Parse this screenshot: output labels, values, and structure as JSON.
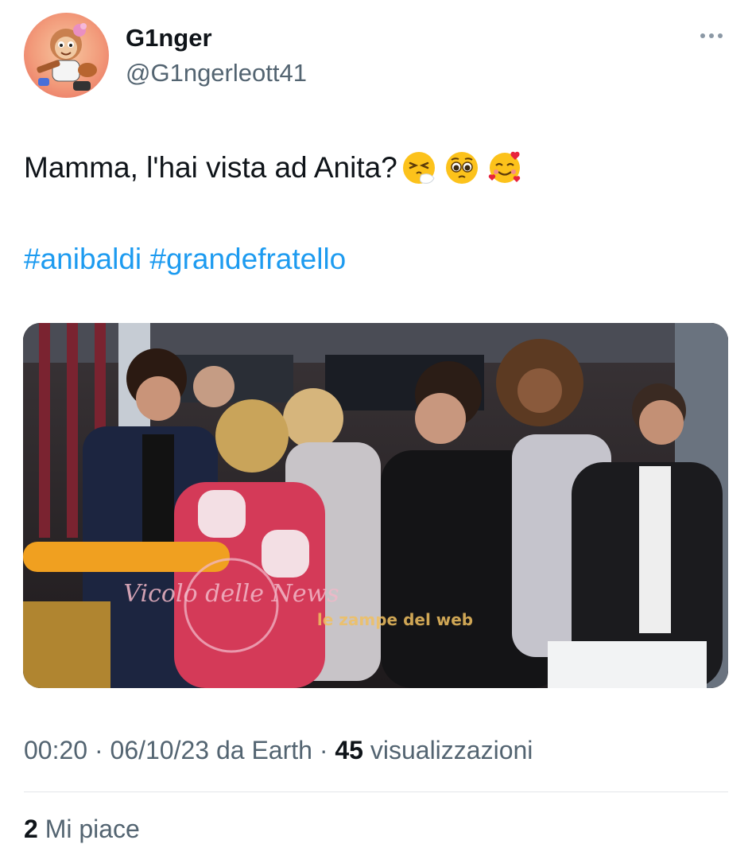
{
  "author": {
    "name": "G1nger",
    "handle": "@G1ngerleott41",
    "avatar_icon": "cartoon-squirrel-avatar"
  },
  "tweet": {
    "text": "Mamma, l'hai vista ad Anita?",
    "emojis": [
      "sneezing-face-emoji",
      "pleading-face-emoji",
      "smiling-face-with-hearts-emoji"
    ],
    "hashtags": [
      "#anibaldi",
      "#grandefratello"
    ]
  },
  "media": {
    "watermark_left": "Vicolo delle News",
    "watermark_right": "le zampe del web"
  },
  "meta": {
    "time": "00:20",
    "separator": "·",
    "date": "06/10/23 da Earth",
    "views_count": "45",
    "views_label": "visualizzazioni"
  },
  "engagement": {
    "likes_count": "2",
    "likes_label": "Mi piace"
  },
  "colors": {
    "text": "#0f1419",
    "secondary": "#536471",
    "link": "#1d9bf0",
    "divider": "#e3e6e9"
  }
}
